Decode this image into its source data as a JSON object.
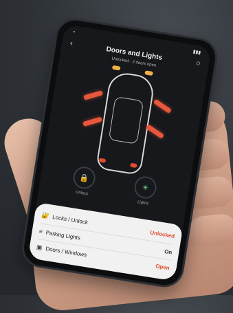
{
  "app": {
    "title": "Doors and Lights",
    "subtitle": "Unlocked · 2 doors open"
  },
  "controls": [
    {
      "label": "Unlock",
      "icon": "lock-icon"
    },
    {
      "label": "Lights",
      "icon": "bulb-icon"
    }
  ],
  "panel": {
    "rows": [
      {
        "label": "Locks / Unlock",
        "status": "Unlocked",
        "status_color": "#e04b2f"
      },
      {
        "label": "Parking Lights",
        "status": "On",
        "status_color": "#333333"
      },
      {
        "label": "Doors / Windows",
        "status": "Open",
        "status_color": "#e04b2f"
      }
    ]
  },
  "colors": {
    "accent": "#e8573b",
    "light_green": "#6bcf8f"
  }
}
